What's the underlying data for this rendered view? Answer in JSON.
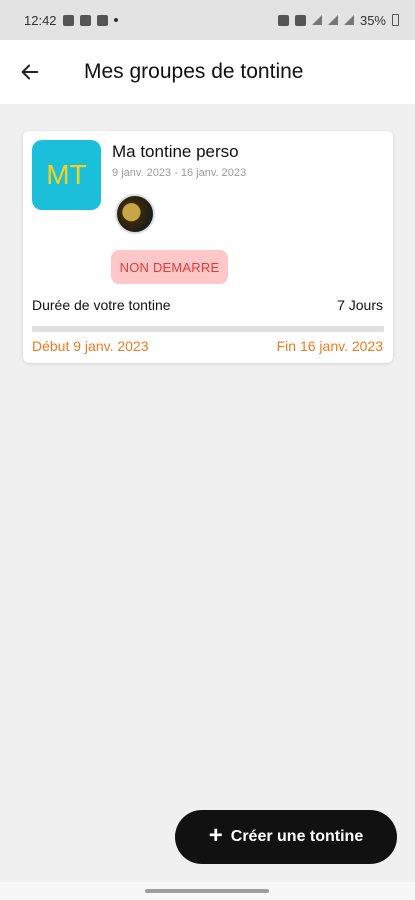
{
  "status_bar": {
    "time": "12:42",
    "battery": "35%"
  },
  "app_bar": {
    "title": "Mes groupes de tontine"
  },
  "group_card": {
    "initials": "MT",
    "name": "Ma tontine perso",
    "date_range": "9 janv. 2023 - 16 janv. 2023",
    "status": "NON DEMARRE",
    "duration_label": "Durée de votre tontine",
    "duration_value": "7 Jours",
    "progress": 0,
    "start": "Début 9 janv. 2023",
    "end": "Fin 16 janv. 2023"
  },
  "fab": {
    "label": "Créer une tontine"
  },
  "colors": {
    "avatar_bg": "#1bbfd9",
    "avatar_text": "#f4d21e",
    "badge_bg": "#ffc7c7",
    "badge_text": "#e23b3b",
    "date_accent": "#f07a1c",
    "fab_bg": "#111111"
  },
  "icons": {
    "back": "arrow-left-icon",
    "fab": "plus-icon"
  }
}
